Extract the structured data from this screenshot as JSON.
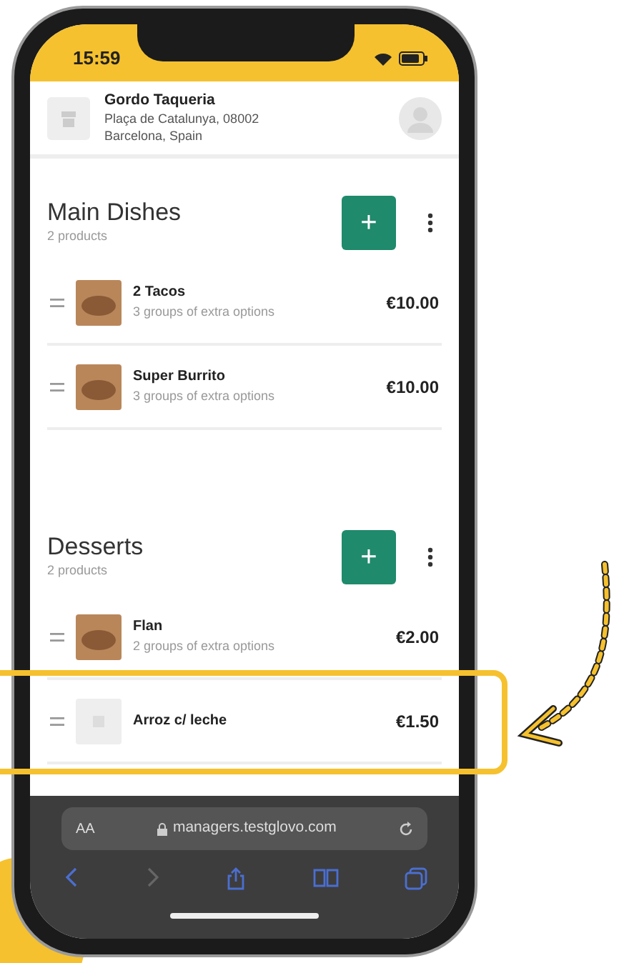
{
  "status_bar": {
    "time": "15:59"
  },
  "store": {
    "name": "Gordo Taqueria",
    "address_line_1": "Plaça de Catalunya, 08002",
    "address_line_2": "Barcelona, Spain"
  },
  "categories": [
    {
      "title": "Main Dishes",
      "count": "2 products",
      "add_button": "+",
      "products": [
        {
          "kind": "photo",
          "name": "2 Tacos",
          "options": "3 groups of extra options",
          "price": "€10.00",
          "highlighted": false
        },
        {
          "kind": "photo",
          "name": "Super Burrito",
          "options": "3 groups of extra options",
          "price": "€10.00",
          "highlighted": false
        }
      ]
    },
    {
      "title": "Desserts",
      "count": "2 products",
      "add_button": "+",
      "products": [
        {
          "kind": "photo",
          "name": "Flan",
          "options": "2 groups of extra options",
          "price": "€2.00",
          "highlighted": false
        },
        {
          "kind": "placeholder",
          "name": "Arroz c/ leche",
          "price": "€1.50",
          "highlighted": true
        }
      ]
    }
  ],
  "browser": {
    "text_size": "AA",
    "url": "managers.testglovo.com"
  }
}
